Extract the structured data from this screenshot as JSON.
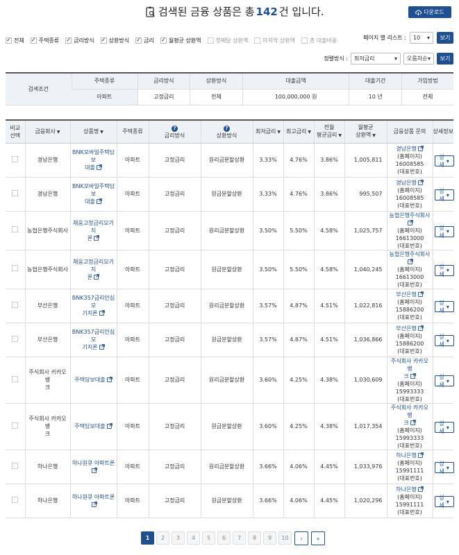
{
  "header": {
    "title_prefix": "검색된 금융 상품은 총",
    "count": "142",
    "title_suffix": "건 입니다.",
    "download_label": "다운로드"
  },
  "filters": [
    {
      "label": "전체",
      "checked": true
    },
    {
      "label": "주택종류",
      "checked": true
    },
    {
      "label": "금리방식",
      "checked": true
    },
    {
      "label": "상환방식",
      "checked": true
    },
    {
      "label": "금리",
      "checked": true
    },
    {
      "label": "월평균 상환액",
      "checked": true
    },
    {
      "label": "첫째달 상환액",
      "checked": false
    },
    {
      "label": "마지막 상환액",
      "checked": false
    },
    {
      "label": "총 대출비용",
      "checked": false
    }
  ],
  "perpage": {
    "label": "페이지 별 리스트 :",
    "value": "10",
    "button": "보기"
  },
  "sort": {
    "label": "정렬방식 :",
    "field": "최저금리",
    "order": "오름차순",
    "button": "보기"
  },
  "condition": {
    "row_label": "검색조건",
    "headers": [
      "주택종류",
      "금리방식",
      "상환방식",
      "대출금액",
      "대출기간",
      "가입방법"
    ],
    "values": [
      "아파트",
      "고정금리",
      "전체",
      "100,000,000 원",
      "10 년",
      "전체"
    ]
  },
  "table": {
    "headers": {
      "compare": [
        "비교",
        "선택"
      ],
      "company": "금융회사",
      "product": "상품명",
      "house": "주택종류",
      "rate_type": "금리방식",
      "repay": "상환방식",
      "min_rate": "최저금리",
      "max_rate": "최고금리",
      "avg_rate": [
        "전월",
        "평균금리"
      ],
      "monthly": [
        "월평균",
        "상환액"
      ],
      "inquiry": "금융상품 문의",
      "detail": "상세정보"
    },
    "rows": [
      {
        "company": "경남은행",
        "product": [
          "BNK모바일주택담보",
          "대출"
        ],
        "house": "아파트",
        "rate_type": "고정금리",
        "repay": "원리금분할상환",
        "min": "3.33%",
        "max": "4.76%",
        "avg": "3.86%",
        "monthly": "1,005,811",
        "bank": [
          "경남은행"
        ],
        "home": "(홈페이지)",
        "phone": "16008585",
        "rep": "(대표번호)",
        "detail": "상세"
      },
      {
        "company": "경남은행",
        "product": [
          "BNK모바일주택담보",
          "대출"
        ],
        "house": "아파트",
        "rate_type": "고정금리",
        "repay": "원금분할상환",
        "min": "3.33%",
        "max": "4.76%",
        "avg": "3.86%",
        "monthly": "995,507",
        "bank": [
          "경남은행"
        ],
        "home": "(홈페이지)",
        "phone": "16008585",
        "rep": "(대표번호)",
        "detail": "상세"
      },
      {
        "company": "농협은행주식회사",
        "product": [
          "채움고정금리모기지",
          "론"
        ],
        "house": "아파트",
        "rate_type": "고정금리",
        "repay": "원리금분할상환",
        "min": "3.50%",
        "max": "5.50%",
        "avg": "4.58%",
        "monthly": "1,025,757",
        "bank": [
          "농협은행주식회사"
        ],
        "home": "(홈페이지)",
        "phone": "16613000",
        "rep": "(대표번호)",
        "detail": "상세"
      },
      {
        "company": "농협은행주식회사",
        "product": [
          "채움고정금리모기지",
          "론"
        ],
        "house": "아파트",
        "rate_type": "고정금리",
        "repay": "원금분할상환",
        "min": "3.50%",
        "max": "5.50%",
        "avg": "4.58%",
        "monthly": "1,040,245",
        "bank": [
          "농협은행주식회사"
        ],
        "home": "(홈페이지)",
        "phone": "16613000",
        "rep": "(대표번호)",
        "detail": "상세"
      },
      {
        "company": "부산은행",
        "product": [
          "BNK357금리안심모",
          "기지론"
        ],
        "house": "아파트",
        "rate_type": "고정금리",
        "repay": "원리금분할상환",
        "min": "3.57%",
        "max": "4.87%",
        "avg": "4.51%",
        "monthly": "1,022,816",
        "bank": [
          "부산은행"
        ],
        "home": "(홈페이지)",
        "phone": "15886200",
        "rep": "(대표번호)",
        "detail": "상세"
      },
      {
        "company": "부산은행",
        "product": [
          "BNK357금리안심모",
          "기지론"
        ],
        "house": "아파트",
        "rate_type": "고정금리",
        "repay": "원금분할상환",
        "min": "3.57%",
        "max": "4.87%",
        "avg": "4.51%",
        "monthly": "1,036,866",
        "bank": [
          "부산은행"
        ],
        "home": "(홈페이지)",
        "phone": "15886200",
        "rep": "(대표번호)",
        "detail": "상세"
      },
      {
        "company": [
          "주식회사 카카오뱅",
          "크"
        ],
        "product": [
          "주택담보대출"
        ],
        "house": "아파트",
        "rate_type": "고정금리",
        "repay": "원리금분할상환",
        "min": "3.60%",
        "max": "4.25%",
        "avg": "4.38%",
        "monthly": "1,030,609",
        "bank": [
          "주식회사 카카오뱅",
          "크"
        ],
        "home": "(홈페이지)",
        "phone": "15993333",
        "rep": "(대표번호)",
        "detail": "상세"
      },
      {
        "company": [
          "주식회사 카카오뱅",
          "크"
        ],
        "product": [
          "주택담보대출"
        ],
        "house": "아파트",
        "rate_type": "고정금리",
        "repay": "원금분할상환",
        "min": "3.60%",
        "max": "4.25%",
        "avg": "4.38%",
        "monthly": "1,017,354",
        "bank": [
          "주식회사 카카오뱅",
          "크"
        ],
        "home": "(홈페이지)",
        "phone": "15993333",
        "rep": "(대표번호)",
        "detail": "상세"
      },
      {
        "company": "하나은행",
        "product": [
          "하나원큐 아파트론"
        ],
        "house": "아파트",
        "rate_type": "고정금리",
        "repay": "원리금분할상환",
        "min": "3.66%",
        "max": "4.06%",
        "avg": "4.45%",
        "monthly": "1,033,976",
        "bank": [
          "하나은행"
        ],
        "home": "(홈페이지)",
        "phone": "15991111",
        "rep": "(대표번호)",
        "detail": "상세"
      },
      {
        "company": "하나은행",
        "product": [
          "하나원큐 아파트론"
        ],
        "house": "아파트",
        "rate_type": "고정금리",
        "repay": "원금분할상환",
        "min": "3.66%",
        "max": "4.06%",
        "avg": "4.45%",
        "monthly": "1,020,296",
        "bank": [
          "하나은행"
        ],
        "home": "(홈페이지)",
        "phone": "15991111",
        "rep": "(대표번호)",
        "detail": "상세"
      }
    ]
  },
  "pagination": {
    "pages": [
      "1",
      "2",
      "3",
      "4",
      "5",
      "6",
      "7",
      "8",
      "9",
      "10"
    ],
    "current": "1",
    "next": "›",
    "last": "»"
  },
  "colors": {
    "accent": "#1d4f91",
    "header_bg": "#eef2f6"
  }
}
